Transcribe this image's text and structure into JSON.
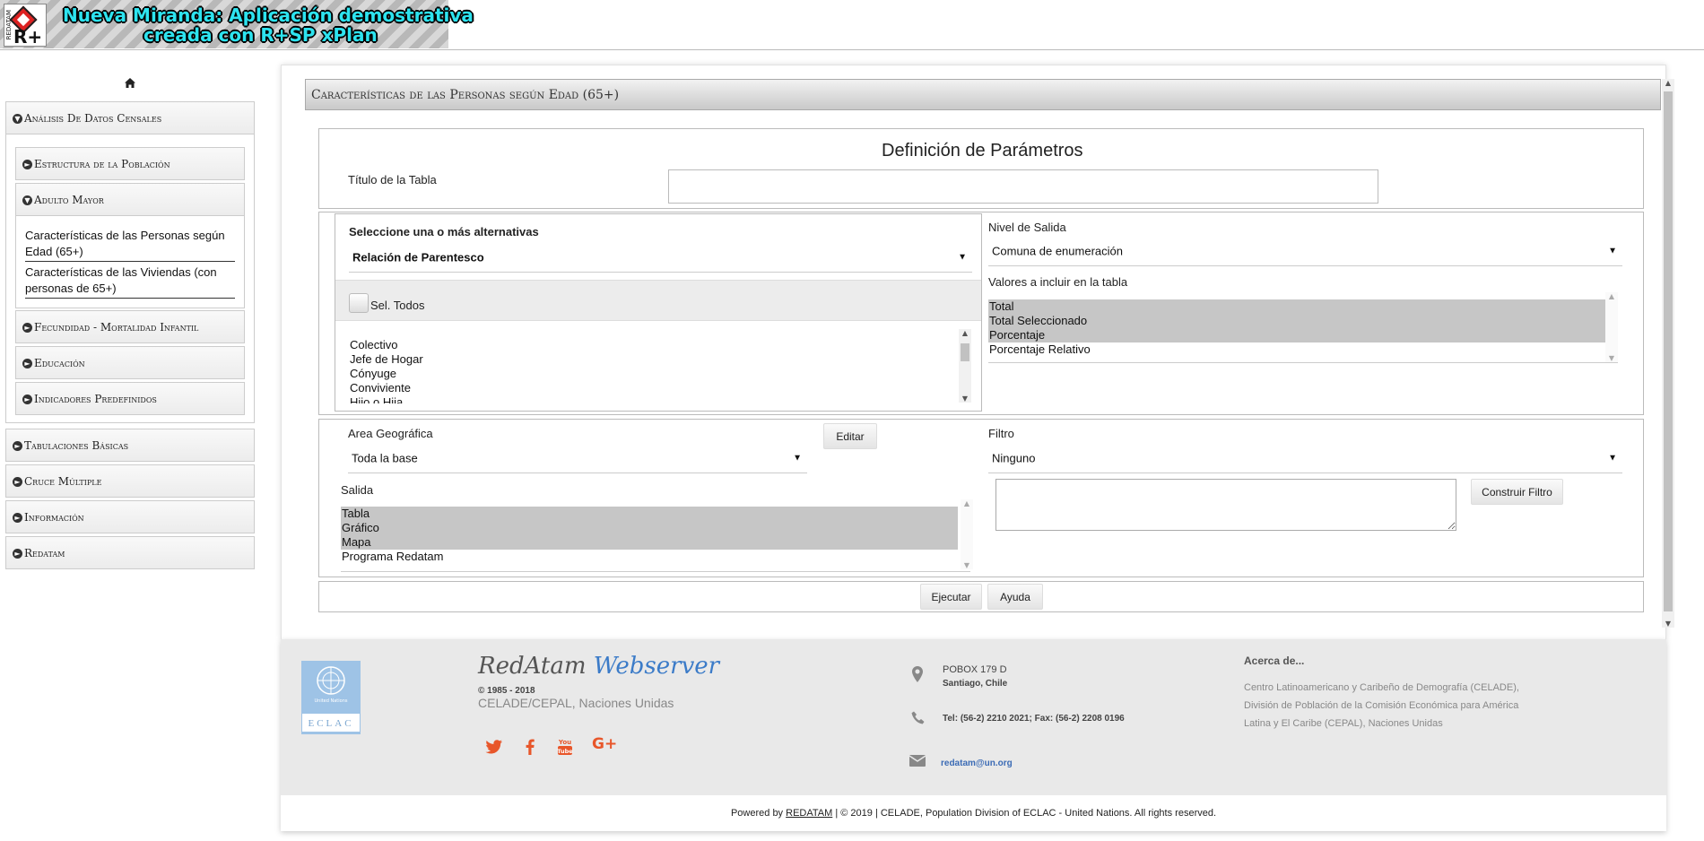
{
  "header": {
    "banner_line1": "Nueva Miranda: Aplicación demostrativa",
    "banner_line2": "creada con R+SP xPlan",
    "logo_text": "R+",
    "logo_side_text": "REDATAM"
  },
  "sidebar": {
    "home_icon": "home-icon",
    "sections": [
      {
        "label": "Análisis De Datos Censales",
        "icon": "circle-down-icon",
        "expanded": true
      },
      {
        "label": "Tabulaciones Básicas",
        "icon": "circle-right-icon"
      },
      {
        "label": "Cruce Múltiple",
        "icon": "circle-right-icon"
      },
      {
        "label": "Información",
        "icon": "circle-right-icon"
      },
      {
        "label": "Redatam",
        "icon": "circle-right-icon"
      }
    ],
    "subsections": [
      {
        "label": "Estructura de la Población",
        "icon": "circle-right-icon"
      },
      {
        "label": "Adulto Mayor",
        "icon": "circle-down-icon",
        "expanded": true
      },
      {
        "label": "Fecundidad - Mortalidad Infantil",
        "icon": "circle-right-icon"
      },
      {
        "label": "Educación",
        "icon": "circle-right-icon"
      },
      {
        "label": "Indicadores Predefinidos",
        "icon": "circle-right-icon"
      }
    ],
    "links": [
      {
        "line1": "Características de las Personas según",
        "line2": "Edad (65+)"
      },
      {
        "line1": "Características de las Viviendas (con",
        "line2": "personas de 65+)"
      }
    ]
  },
  "main": {
    "panel_title": "Características de las Personas según Edad (65+)",
    "params_heading": "Definición de Parámetros",
    "table_title_label": "Título de la Tabla",
    "table_title_value": "",
    "alternatives_label": "Seleccione una o más alternativas",
    "alternatives_select": "Relación de Parentesco",
    "select_all_label": "Sel. Todos",
    "alternatives_options": [
      "Colectivo",
      "Jefe de Hogar",
      "Cónyuge",
      "Conviviente",
      "Hijo o Hija"
    ],
    "output_level_label": "Nivel de Salida",
    "output_level_value": "Comuna de enumeración",
    "values_label": "Valores a incluir en la tabla",
    "values_options": [
      {
        "label": "Total",
        "selected": true
      },
      {
        "label": "Total Seleccionado",
        "selected": true
      },
      {
        "label": "Porcentaje",
        "selected": true
      },
      {
        "label": "Porcentaje Relativo",
        "selected": false
      }
    ],
    "geo_label": "Area Geográfica",
    "geo_value": "Toda la base",
    "edit_button": "Editar",
    "filter_label": "Filtro",
    "filter_value": "Ninguno",
    "filter_text": "",
    "build_filter_button": "Construir Filtro",
    "output_label": "Salida",
    "output_options": [
      {
        "label": "Tabla",
        "selected": true
      },
      {
        "label": "Gráfico",
        "selected": true
      },
      {
        "label": "Mapa",
        "selected": true
      },
      {
        "label": "Programa Redatam",
        "selected": false
      }
    ],
    "run_button": "Ejecutar",
    "help_button": "Ayuda"
  },
  "footer": {
    "brand_a": "RedAtam",
    "brand_b": "Webserver",
    "copyright_years": "© 1985 - 2018",
    "org": "CELADE/CEPAL, Naciones Unidas",
    "un_logo_text": "United Nations",
    "eclac_text": "ECLAC",
    "address_line1": "POBOX 179 D",
    "address_line2": "Santiago, Chile",
    "phone": "Tel: (56-2) 2210 2021; Fax: (56-2) 2208 0196",
    "email": "redatam@un.org",
    "about_title": "Acerca de...",
    "about_line1": "Centro Latinoamericano y Caribeño de Demografía (CELADE),",
    "about_line2": "División de Población de la Comisión Económica para América",
    "about_line3": "Latina y El Caribe (CEPAL), Naciones Unidas",
    "powered_prefix": "Powered by ",
    "powered_link": "REDATAM",
    "powered_suffix": " | © 2019 | CELADE, Population Division of ECLAC - United Nations. All rights reserved.",
    "colors": {
      "social": "#e8562a",
      "email": "#3b6bb5",
      "brand_b": "#3b7bc8"
    }
  }
}
